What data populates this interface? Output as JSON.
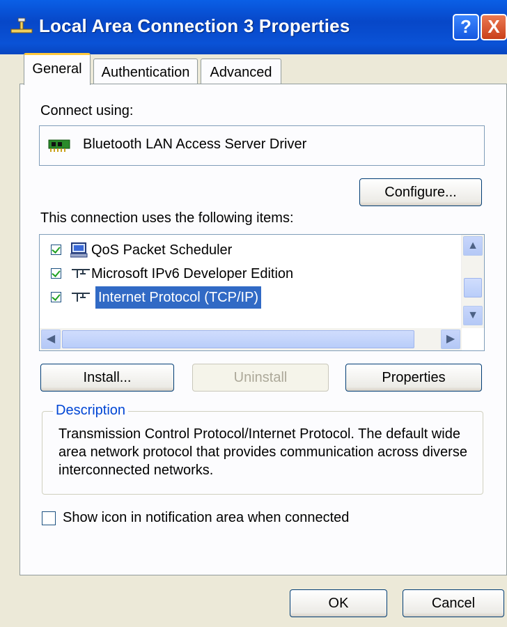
{
  "window": {
    "title": "Local Area Connection 3 Properties",
    "help_label": "?",
    "close_label": "X"
  },
  "tabs": [
    {
      "label": "General",
      "active": true
    },
    {
      "label": "Authentication",
      "active": false
    },
    {
      "label": "Advanced",
      "active": false
    }
  ],
  "general": {
    "connect_using_label": "Connect using:",
    "adapter_name": "Bluetooth LAN Access Server Driver",
    "configure_label": "Configure...",
    "items_label": "This connection uses the following items:",
    "items": [
      {
        "label": "QoS Packet Scheduler",
        "checked": true,
        "icon": "scheduler-icon"
      },
      {
        "label": "Microsoft IPv6 Developer Edition",
        "checked": true,
        "icon": "protocol-icon"
      },
      {
        "label": "Internet Protocol (TCP/IP)",
        "checked": true,
        "icon": "protocol-icon",
        "selected": true
      }
    ],
    "install_label": "Install...",
    "uninstall_label": "Uninstall",
    "properties_label": "Properties",
    "description_title": "Description",
    "description_text": "Transmission Control Protocol/Internet Protocol. The default wide area network protocol that provides communication across diverse interconnected networks.",
    "show_icon_label": "Show icon in notification area when connected",
    "show_icon_checked": false
  },
  "footer": {
    "ok_label": "OK",
    "cancel_label": "Cancel"
  },
  "colors": {
    "titlebar": "#0a52d6",
    "selection": "#316ac5",
    "group_title": "#0046d5",
    "dialog_bg": "#ece9d8"
  }
}
